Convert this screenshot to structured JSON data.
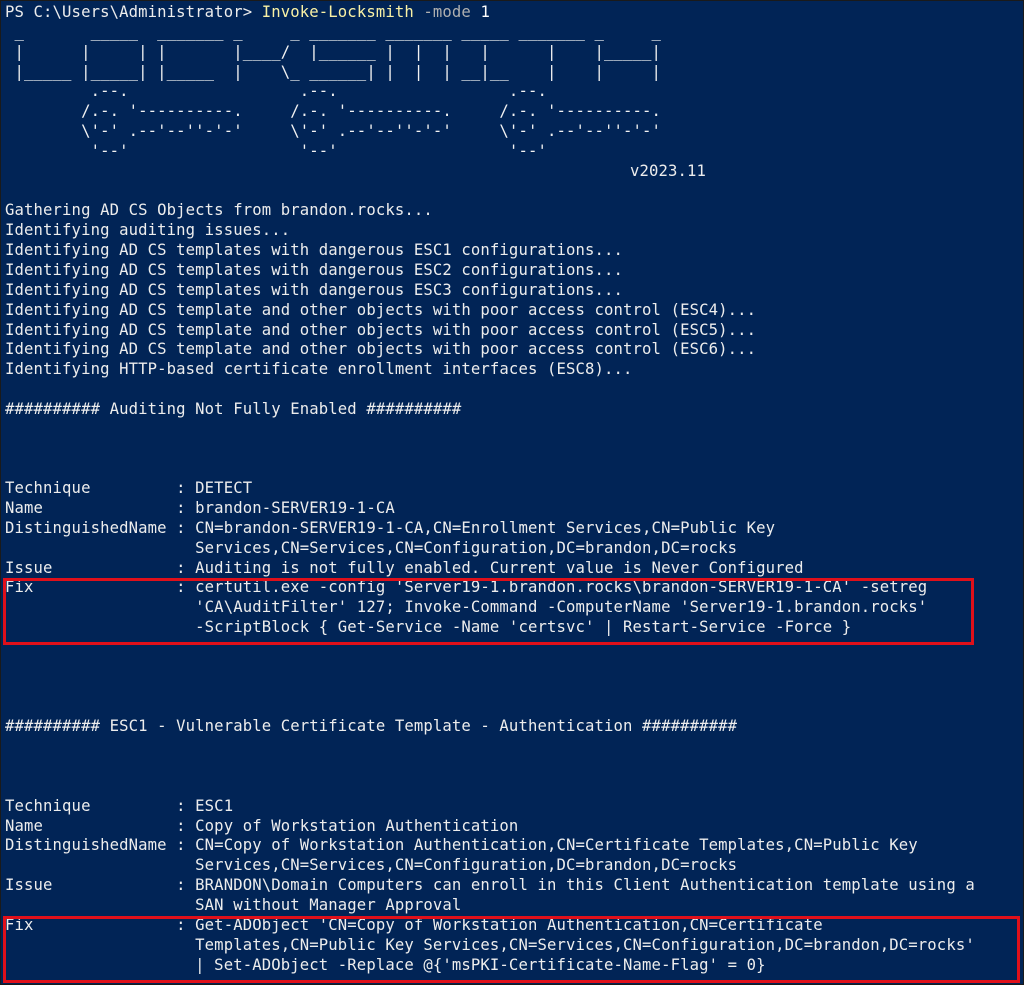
{
  "prompt": {
    "path": "PS C:\\Users\\Administrator> ",
    "command": "Invoke-Locksmith",
    "param": " -mode",
    "value": " 1"
  },
  "banner": {
    "art": [
      " _       _____  _______ _     _ _______ _______ _____ _______ _     _",
      " |      |     | |       |____/  |______ |  |  |   |      |    |_____|",
      " |_____ |_____| |_____  |    \\_ ______| |  |  | __|__    |    |     |",
      "         .--.                  .--.                  .--.",
      "        /.-. '----------.     /.-. '----------.     /.-. '----------.",
      "        \\'-' .--'--''-'-'     \\'-' .--'--''-'-'     \\'-' .--'--''-'-'",
      "         '--'                  '--'                  '--'"
    ],
    "version": "v2023.11"
  },
  "progress": [
    "Gathering AD CS Objects from brandon.rocks...",
    "Identifying auditing issues...",
    "Identifying AD CS templates with dangerous ESC1 configurations...",
    "Identifying AD CS templates with dangerous ESC2 configurations...",
    "Identifying AD CS templates with dangerous ESC3 configurations...",
    "Identifying AD CS template and other objects with poor access control (ESC4)...",
    "Identifying AD CS template and other objects with poor access control (ESC5)...",
    "Identifying AD CS template and other objects with poor access control (ESC6)...",
    "Identifying HTTP-based certificate enrollment interfaces (ESC8)..."
  ],
  "sections": [
    {
      "header": "########## Auditing Not Fully Enabled ##########",
      "rows": [
        "Technique         : DETECT",
        "Name              : brandon-SERVER19-1-CA",
        "DistinguishedName : CN=brandon-SERVER19-1-CA,CN=Enrollment Services,CN=Public Key",
        "                    Services,CN=Services,CN=Configuration,DC=brandon,DC=rocks",
        "Issue             : Auditing is not fully enabled. Current value is Never Configured"
      ],
      "fix": [
        "Fix               : certutil.exe -config 'Server19-1.brandon.rocks\\brandon-SERVER19-1-CA' -setreg",
        "                    'CA\\AuditFilter' 127; Invoke-Command -ComputerName 'Server19-1.brandon.rocks'",
        "                    -ScriptBlock { Get-Service -Name 'certsvc' | Restart-Service -Force }"
      ]
    },
    {
      "header": "########## ESC1 - Vulnerable Certificate Template - Authentication ##########",
      "rows": [
        "Technique         : ESC1",
        "Name              : Copy of Workstation Authentication",
        "DistinguishedName : CN=Copy of Workstation Authentication,CN=Certificate Templates,CN=Public Key",
        "                    Services,CN=Services,CN=Configuration,DC=brandon,DC=rocks",
        "Issue             : BRANDON\\Domain Computers can enroll in this Client Authentication template using a",
        "                    SAN without Manager Approval"
      ],
      "fix": [
        "Fix               : Get-ADObject 'CN=Copy of Workstation Authentication,CN=Certificate",
        "                    Templates,CN=Public Key Services,CN=Services,CN=Configuration,DC=brandon,DC=rocks'",
        "                    | Set-ADObject -Replace @{'msPKI-Certificate-Name-Flag' = 0}"
      ]
    }
  ],
  "colors": {
    "background": "#012456",
    "text": "#ededed",
    "command": "#f9f1a5",
    "parameter": "#b0b0b0",
    "highlight_box": "#e0101a"
  }
}
